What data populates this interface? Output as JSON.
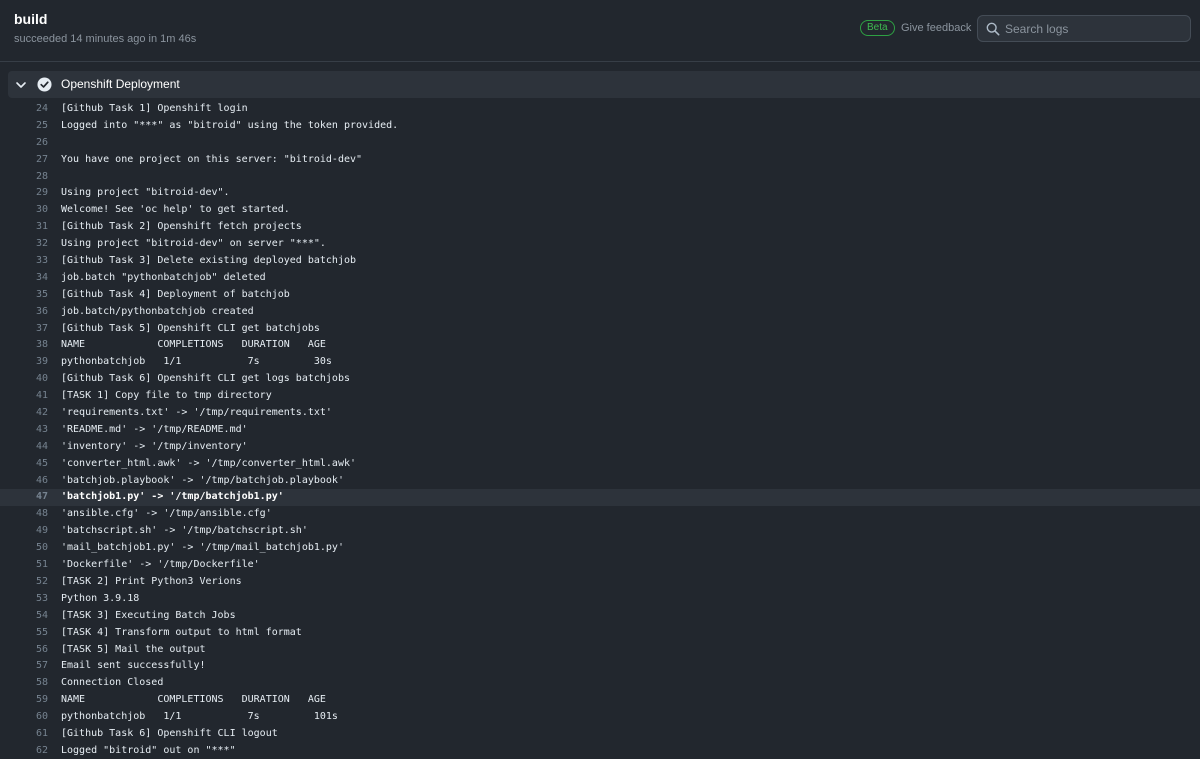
{
  "header": {
    "title": "build",
    "status": "succeeded 14 minutes ago in 1m 46s",
    "beta_label": "Beta",
    "feedback_label": "Give feedback",
    "search_placeholder": "Search logs"
  },
  "step": {
    "title": "Openshift Deployment",
    "status": "success",
    "expanded": true
  },
  "colors": {
    "background": "#22272e",
    "success": "#3fb950",
    "highlight_row": "#2d333b"
  },
  "log": {
    "highlighted_line": "47",
    "lines": [
      {
        "num": "24",
        "text": "[Github Task 1] Openshift login"
      },
      {
        "num": "25",
        "text": "Logged into \"***\" as \"bitroid\" using the token provided."
      },
      {
        "num": "26",
        "text": ""
      },
      {
        "num": "27",
        "text": "You have one project on this server: \"bitroid-dev\""
      },
      {
        "num": "28",
        "text": ""
      },
      {
        "num": "29",
        "text": "Using project \"bitroid-dev\"."
      },
      {
        "num": "30",
        "text": "Welcome! See 'oc help' to get started."
      },
      {
        "num": "31",
        "text": "[Github Task 2] Openshift fetch projects"
      },
      {
        "num": "32",
        "text": "Using project \"bitroid-dev\" on server \"***\"."
      },
      {
        "num": "33",
        "text": "[Github Task 3] Delete existing deployed batchjob"
      },
      {
        "num": "34",
        "text": "job.batch \"pythonbatchjob\" deleted"
      },
      {
        "num": "35",
        "text": "[Github Task 4] Deployment of batchjob"
      },
      {
        "num": "36",
        "text": "job.batch/pythonbatchjob created"
      },
      {
        "num": "37",
        "text": "[Github Task 5] Openshift CLI get batchjobs"
      },
      {
        "num": "38",
        "text": "NAME            COMPLETIONS   DURATION   AGE"
      },
      {
        "num": "39",
        "text": "pythonbatchjob   1/1           7s         30s"
      },
      {
        "num": "40",
        "text": "[Github Task 6] Openshift CLI get logs batchjobs"
      },
      {
        "num": "41",
        "text": "[TASK 1] Copy file to tmp directory"
      },
      {
        "num": "42",
        "text": "'requirements.txt' -> '/tmp/requirements.txt'"
      },
      {
        "num": "43",
        "text": "'README.md' -> '/tmp/README.md'"
      },
      {
        "num": "44",
        "text": "'inventory' -> '/tmp/inventory'"
      },
      {
        "num": "45",
        "text": "'converter_html.awk' -> '/tmp/converter_html.awk'"
      },
      {
        "num": "46",
        "text": "'batchjob.playbook' -> '/tmp/batchjob.playbook'"
      },
      {
        "num": "47",
        "text": "'batchjob1.py' -> '/tmp/batchjob1.py'"
      },
      {
        "num": "48",
        "text": "'ansible.cfg' -> '/tmp/ansible.cfg'"
      },
      {
        "num": "49",
        "text": "'batchscript.sh' -> '/tmp/batchscript.sh'"
      },
      {
        "num": "50",
        "text": "'mail_batchjob1.py' -> '/tmp/mail_batchjob1.py'"
      },
      {
        "num": "51",
        "text": "'Dockerfile' -> '/tmp/Dockerfile'"
      },
      {
        "num": "52",
        "text": "[TASK 2] Print Python3 Verions"
      },
      {
        "num": "53",
        "text": "Python 3.9.18"
      },
      {
        "num": "54",
        "text": "[TASK 3] Executing Batch Jobs"
      },
      {
        "num": "55",
        "text": "[TASK 4] Transform output to html format"
      },
      {
        "num": "56",
        "text": "[TASK 5] Mail the output"
      },
      {
        "num": "57",
        "text": "Email sent successfully!"
      },
      {
        "num": "58",
        "text": "Connection Closed"
      },
      {
        "num": "59",
        "text": "NAME            COMPLETIONS   DURATION   AGE"
      },
      {
        "num": "60",
        "text": "pythonbatchjob   1/1           7s         101s"
      },
      {
        "num": "61",
        "text": "[Github Task 6] Openshift CLI logout"
      },
      {
        "num": "62",
        "text": "Logged \"bitroid\" out on \"***\""
      }
    ]
  }
}
